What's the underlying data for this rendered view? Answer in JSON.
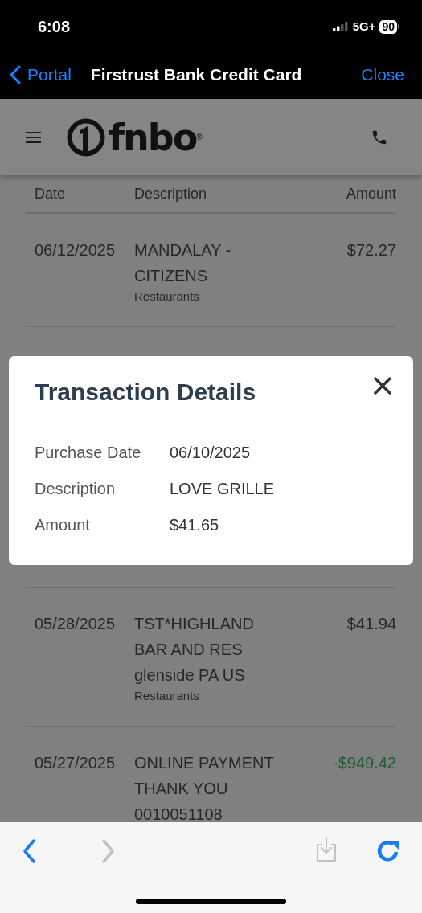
{
  "status_bar": {
    "time": "6:08",
    "network": "5G+",
    "battery": "90"
  },
  "nav_bar": {
    "back_label": "Portal",
    "title": "Firstrust Bank Credit Card",
    "close_label": "Close"
  },
  "header": {
    "logo_text": "fnbo",
    "logo_mark": "®"
  },
  "table": {
    "columns": [
      "Date",
      "Description",
      "Amount"
    ],
    "rows": [
      {
        "date": "06/12/2025",
        "description_lines": [
          "MANDALAY -",
          "CITIZENS"
        ],
        "category": "Restaurants",
        "amount": "$72.27",
        "kind": "purchase"
      },
      {
        "kind": "covered"
      },
      {
        "date": "05/28/2025",
        "description_lines": [
          "TST*HIGHLAND",
          "BAR AND RES",
          "glenside PA US"
        ],
        "category": "Restaurants",
        "amount": "$41.94",
        "kind": "purchase"
      },
      {
        "date": "05/27/2025",
        "description_lines": [
          "ONLINE PAYMENT",
          "THANK YOU",
          "0010051108"
        ],
        "amount": "-$949.42",
        "kind": "payment"
      }
    ]
  },
  "dialog": {
    "title": "Transaction Details",
    "fields": [
      {
        "label": "Purchase Date",
        "value": "06/10/2025"
      },
      {
        "label": "Description",
        "value": "LOVE GRILLE"
      },
      {
        "label": "Amount",
        "value": "$41.65"
      }
    ]
  },
  "toolbar": {
    "back_enabled": true,
    "forward_enabled": false,
    "download_enabled": false
  }
}
